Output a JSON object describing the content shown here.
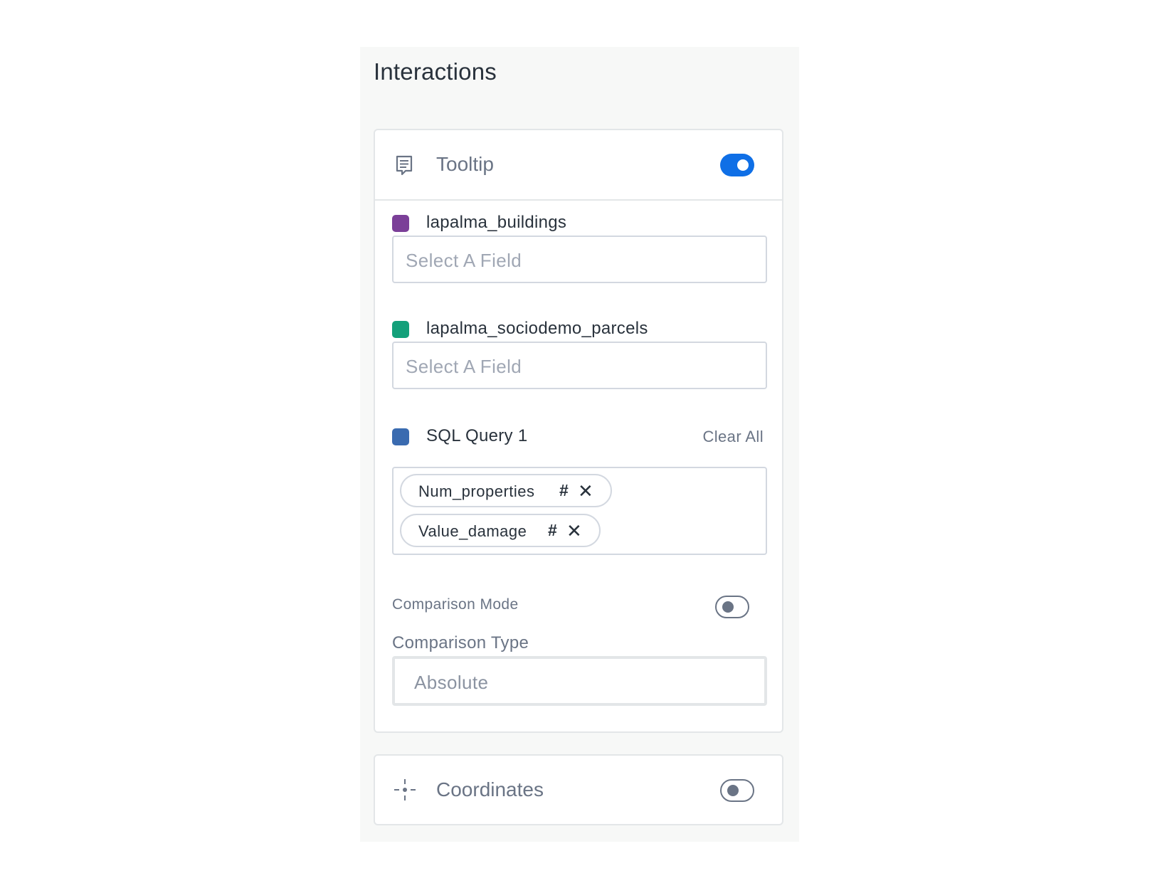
{
  "panel": {
    "title": "Interactions"
  },
  "tooltip": {
    "title": "Tooltip",
    "enabled": true,
    "layers": [
      {
        "name": "lapalma_buildings",
        "color": "#7b3f98",
        "placeholder": "Select A Field"
      },
      {
        "name": "lapalma_sociodemo_parcels",
        "color": "#13a07a",
        "placeholder": "Select A Field"
      },
      {
        "name": "SQL Query 1",
        "color": "#3a6bb0",
        "clear_all_label": "Clear All",
        "fields": [
          {
            "name": "Num_properties",
            "type_symbol": "#",
            "remove_symbol": "✕"
          },
          {
            "name": "Value_damage",
            "type_symbol": "#",
            "remove_symbol": "✕"
          }
        ]
      }
    ],
    "comparison_mode": {
      "label": "Comparison Mode",
      "enabled": false
    },
    "comparison_type": {
      "label": "Comparison Type",
      "value": "Absolute"
    }
  },
  "coordinates": {
    "title": "Coordinates",
    "enabled": false
  },
  "icons": {
    "tooltip": "comment-lines-icon",
    "coordinates": "crosshair-icon"
  }
}
